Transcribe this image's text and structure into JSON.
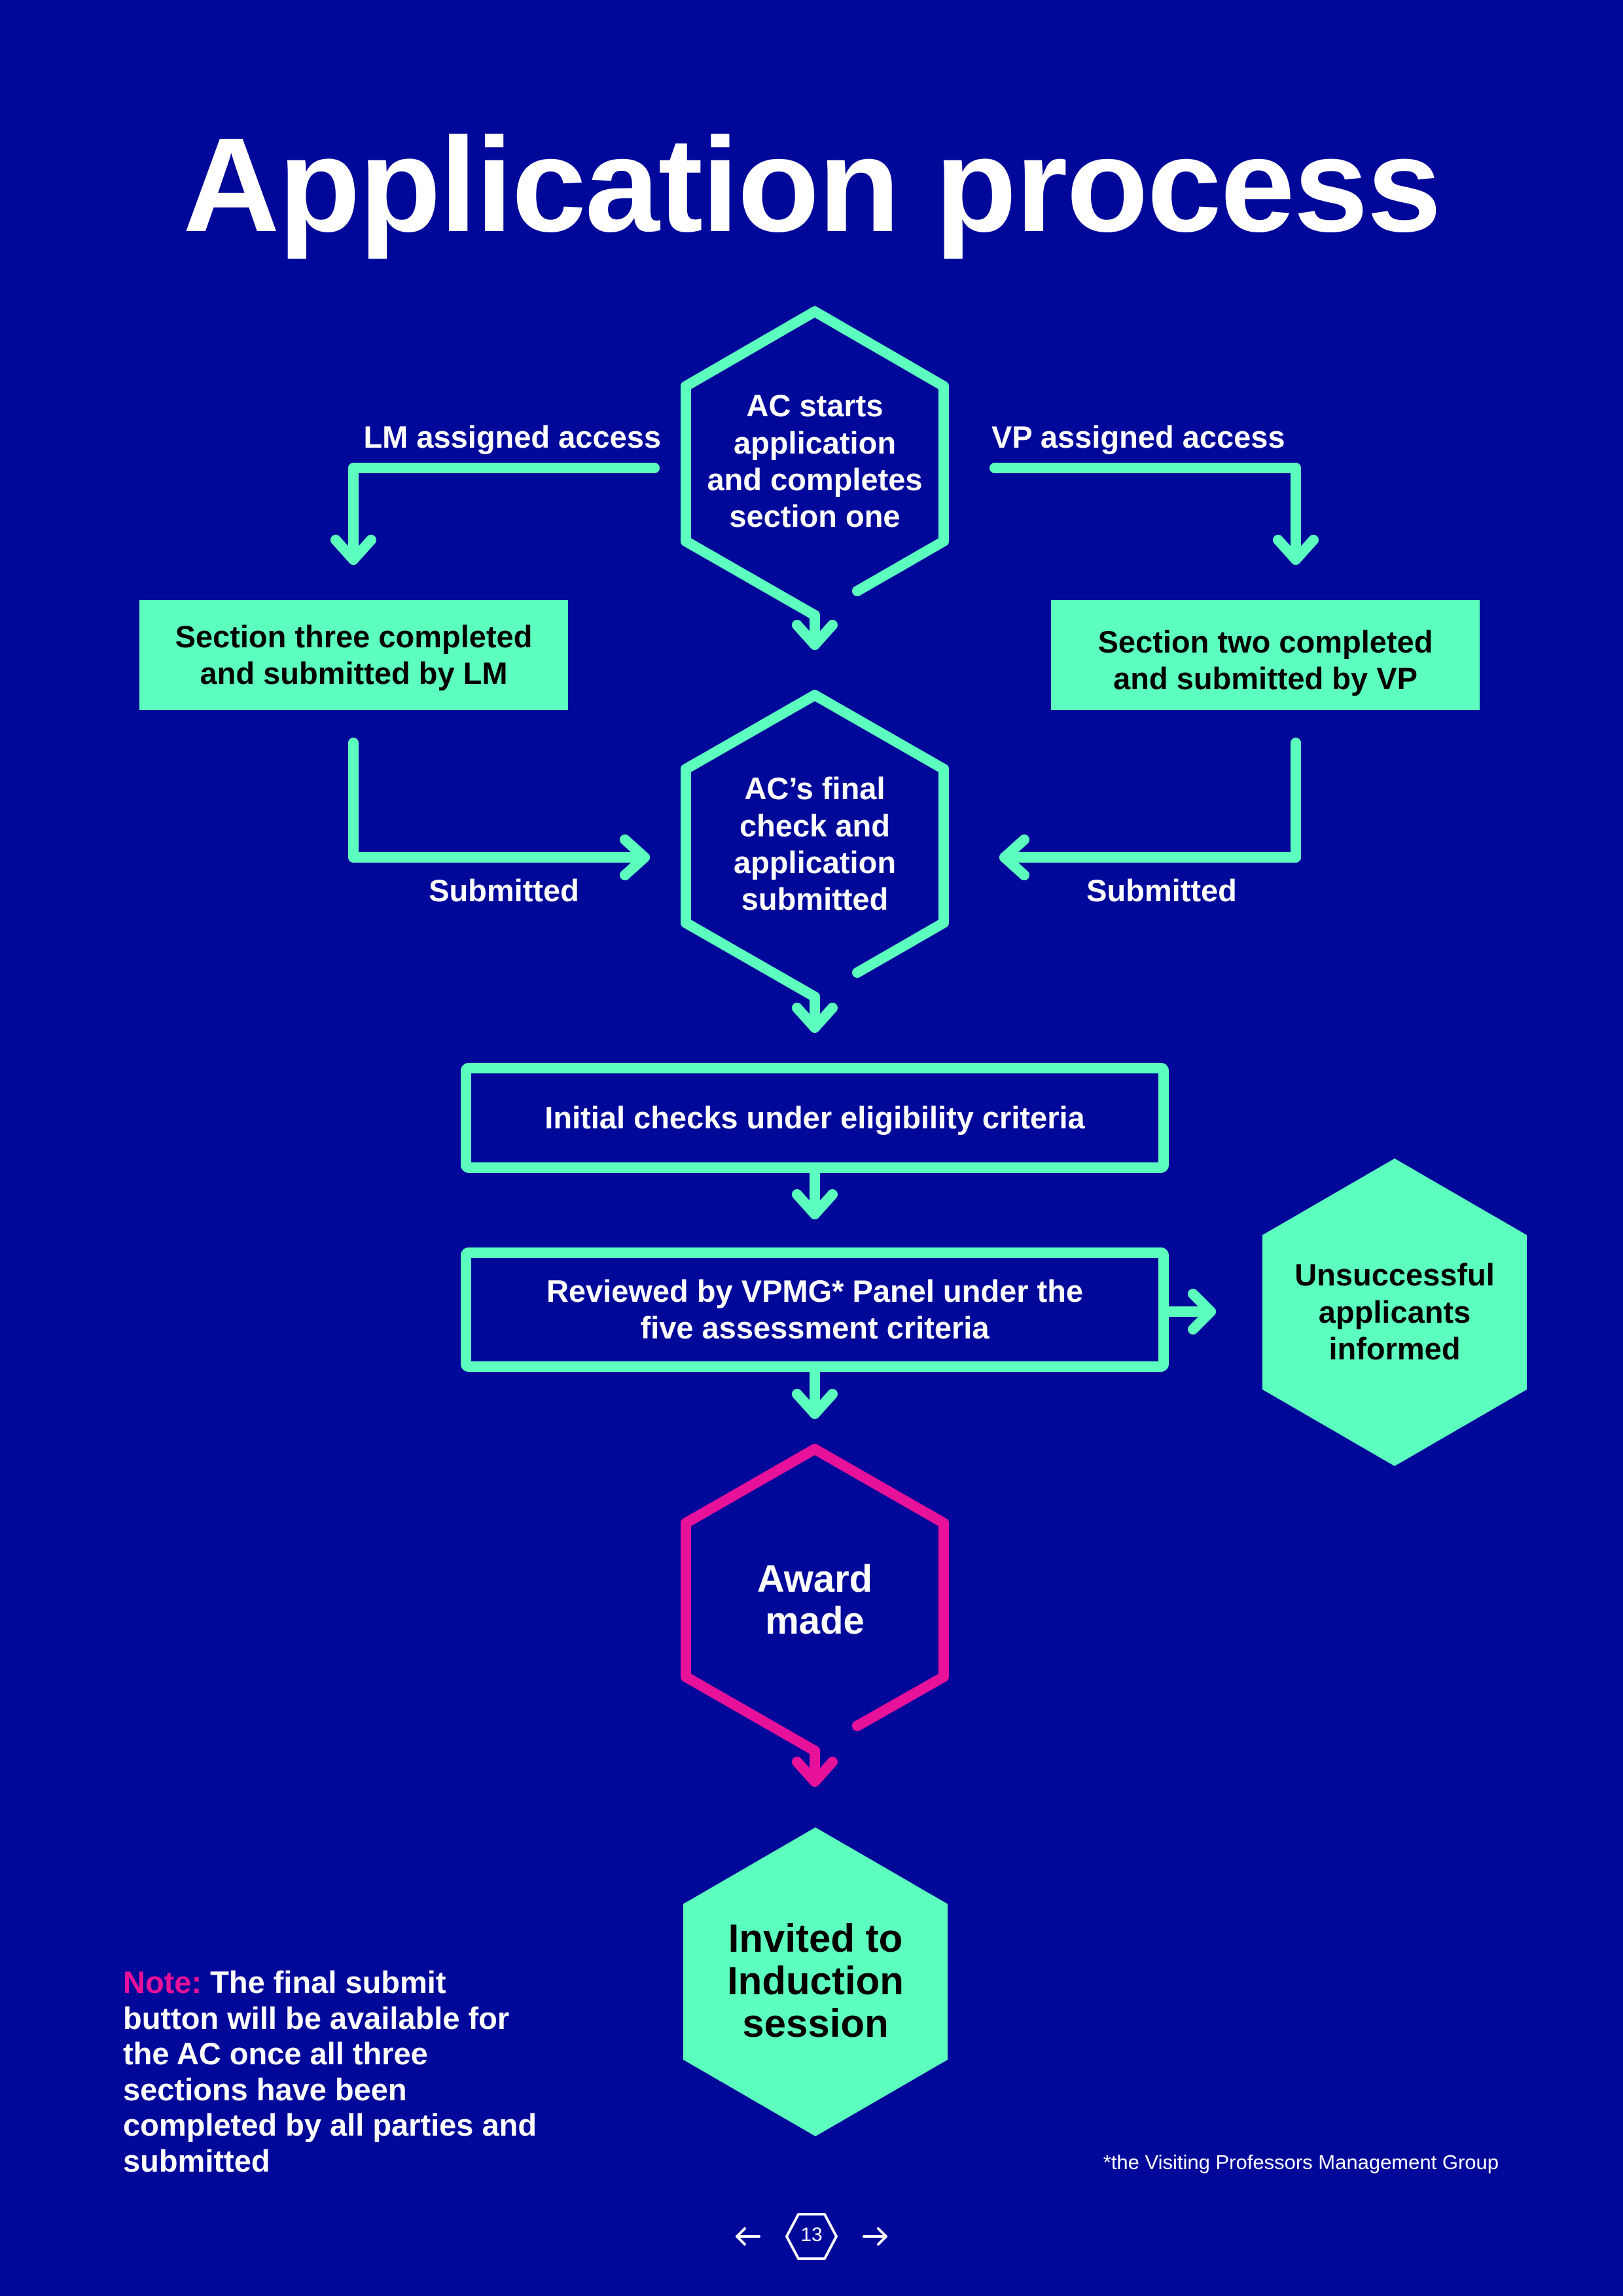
{
  "page": {
    "title": "Application process",
    "colors": {
      "background": "#000899",
      "accent_mint": "#5cffbe",
      "accent_magenta": "#e8119a",
      "text": "#ffffff",
      "text_on_mint": "#000000"
    }
  },
  "flow": {
    "start_node": {
      "shape": "hexagon-outline",
      "text": "AC starts application and completes section one",
      "lines": [
        "AC starts",
        "application",
        "and completes",
        "section one"
      ]
    },
    "lm_access_label": "LM assigned access",
    "vp_access_label": "VP assigned access",
    "lm_section_node": {
      "shape": "rectangle-filled",
      "lines": [
        "Section three completed",
        "and submitted by LM"
      ]
    },
    "vp_section_node": {
      "shape": "rectangle-filled",
      "lines": [
        "Section two completed",
        "and submitted by VP"
      ]
    },
    "lm_submitted_label": "Submitted",
    "vp_submitted_label": "Submitted",
    "final_check_node": {
      "shape": "hexagon-outline",
      "lines": [
        "AC’s final",
        "check and",
        "application",
        "submitted"
      ]
    },
    "initial_checks_node": {
      "shape": "rectangle-outline",
      "lines": [
        "Initial checks under eligibility criteria"
      ]
    },
    "review_node": {
      "shape": "rectangle-outline",
      "lines": [
        "Reviewed by VPMG* Panel under the",
        "five assessment criteria"
      ]
    },
    "unsuccessful_node": {
      "shape": "hexagon-filled",
      "lines": [
        "Unsuccessful",
        "applicants",
        "informed"
      ]
    },
    "award_node": {
      "shape": "hexagon-outline-magenta",
      "lines": [
        "Award",
        "made"
      ]
    },
    "induction_node": {
      "shape": "hexagon-filled",
      "lines": [
        "Invited to",
        "Induction",
        "session"
      ]
    },
    "edges": [
      {
        "from": "start_node",
        "to": "lm_section_node",
        "label": "LM assigned access"
      },
      {
        "from": "start_node",
        "to": "vp_section_node",
        "label": "VP assigned access"
      },
      {
        "from": "start_node",
        "to": "final_check_node",
        "label": ""
      },
      {
        "from": "lm_section_node",
        "to": "final_check_node",
        "label": "Submitted"
      },
      {
        "from": "vp_section_node",
        "to": "final_check_node",
        "label": "Submitted"
      },
      {
        "from": "final_check_node",
        "to": "initial_checks_node",
        "label": ""
      },
      {
        "from": "initial_checks_node",
        "to": "review_node",
        "label": ""
      },
      {
        "from": "review_node",
        "to": "unsuccessful_node",
        "label": ""
      },
      {
        "from": "review_node",
        "to": "award_node",
        "label": ""
      },
      {
        "from": "award_node",
        "to": "induction_node",
        "label": ""
      }
    ]
  },
  "note": {
    "key": "Note:",
    "text": "The final submit button will be available for the AC once all three sections have been completed by all parties and submitted"
  },
  "footnote": "*the Visiting Professors Management Group",
  "pagination": {
    "current_page": "13",
    "prev_icon": "arrow-left-icon",
    "next_icon": "arrow-right-icon"
  }
}
